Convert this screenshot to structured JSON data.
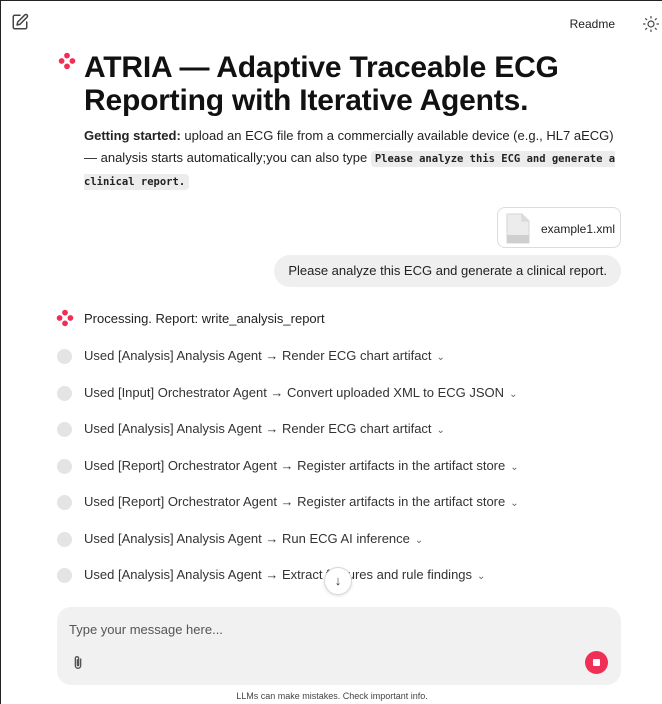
{
  "topbar": {
    "readme_label": "Readme"
  },
  "header": {
    "title": "ATRIA — Adaptive Traceable ECG Reporting with Iterative Agents.",
    "intro_strong": "Getting started:",
    "intro_text": " upload an ECG file from a commercially available device (e.g., HL7 aECG) — analysis starts automatically;you can also type ",
    "intro_code": "Please analyze this ECG and generate a clinical report."
  },
  "conversation": {
    "attachment": {
      "filename": "example1.xml",
      "file_type": "xml"
    },
    "user_message": "Please analyze this ECG and generate a clinical report.",
    "status": "Processing. Report: write_analysis_report",
    "steps": [
      {
        "label": "Used [Analysis] Analysis Agent → Render ECG chart artifact"
      },
      {
        "label": "Used [Input] Orchestrator Agent → Convert uploaded XML to ECG JSON"
      },
      {
        "label": "Used [Analysis] Analysis Agent → Render ECG chart artifact"
      },
      {
        "label": "Used [Report] Orchestrator Agent → Register artifacts in the artifact store"
      },
      {
        "label": "Used [Report] Orchestrator Agent → Register artifacts in the artifact store"
      },
      {
        "label": "Used [Analysis] Analysis Agent → Run ECG AI inference"
      },
      {
        "label": "Used [Analysis] Analysis Agent → Extract features and rule findings"
      }
    ],
    "chevron": "⌄"
  },
  "composer": {
    "placeholder": "Type your message here...",
    "value": ""
  },
  "footer": {
    "disclaimer": "LLMs can make mistakes. Check important info."
  },
  "colors": {
    "accent": "#ef2f55",
    "bubble": "#efefef",
    "composer": "#f1f1f1"
  },
  "icons": {
    "new_chat": "edit-square-icon",
    "theme": "sun-icon",
    "logo": "atria-logo-icon",
    "attach": "paperclip-icon",
    "stop": "stop-icon",
    "scroll": "arrow-down-icon"
  }
}
